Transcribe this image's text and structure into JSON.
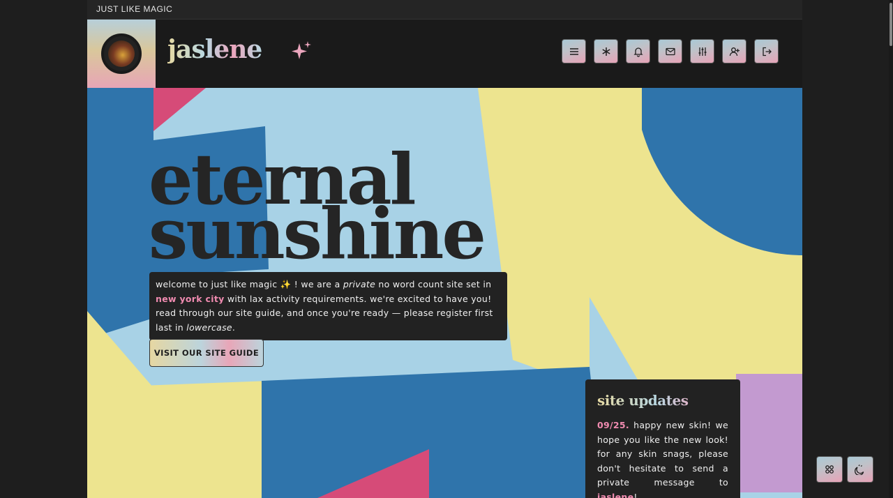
{
  "site": {
    "top_label": "JUST LIKE MAGIC",
    "logo_text": "jaslene"
  },
  "nav": {
    "items": [
      {
        "icon": "menu-icon"
      },
      {
        "icon": "asterisk-icon"
      },
      {
        "icon": "bell-icon"
      },
      {
        "icon": "mail-icon"
      },
      {
        "icon": "sliders-icon"
      },
      {
        "icon": "add-user-icon"
      },
      {
        "icon": "logout-icon"
      }
    ]
  },
  "hero": {
    "title_line1": "eternal",
    "title_line2": "sunshine",
    "welcome": {
      "p1": "welcome to just like magic ",
      "sparkle": "✨",
      "p2": " ! we are a ",
      "private": "private",
      "p3": " no word count site set in ",
      "location": "new york city",
      "p4": " with lax activity requirements. we're excited to have you! read through our site guide, and once you're ready — please register first last in ",
      "lowercase": "lowercase",
      "p5": "."
    },
    "guide_button": "VISIT OUR SITE GUIDE"
  },
  "updates": {
    "title": "site updates",
    "date": "09/25.",
    "text": " happy new skin! we hope you like the new look! for any skin snags, please don't hesitate to send a private message to ",
    "name": "jaslene",
    "end": "!"
  },
  "corner": {
    "left_icon": "grid-icon",
    "right_icon": "moon-toggle-icon"
  },
  "colors": {
    "accent_pink": "#f08bb0",
    "accent_blue": "#b9d8e2",
    "accent_yellow": "#e6d9a3",
    "panel": "#222222"
  }
}
